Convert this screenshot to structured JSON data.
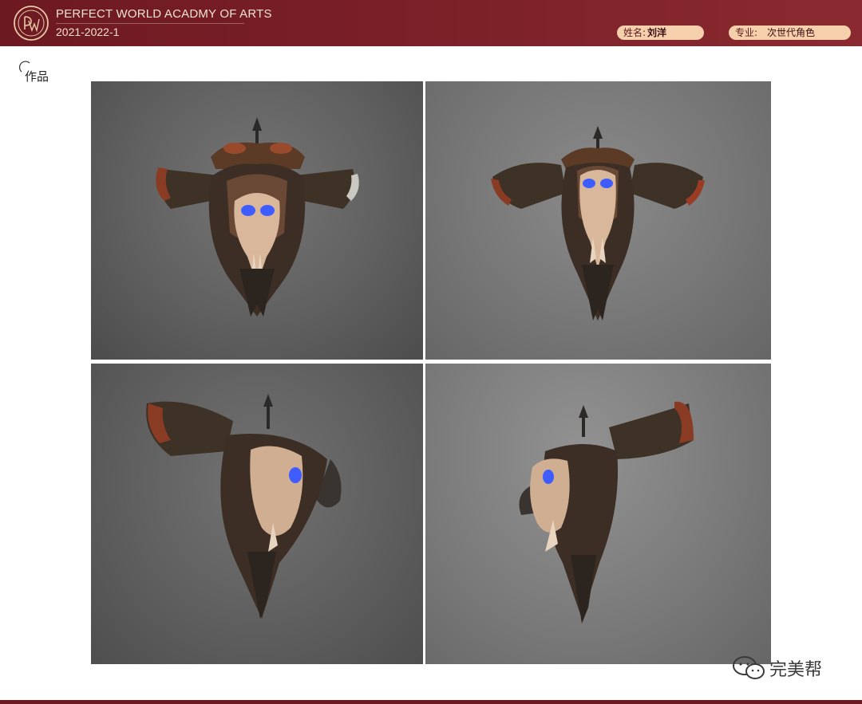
{
  "header": {
    "school": "PERFECT WORLD ACADMY OF ARTS",
    "year": "2021-2022-1",
    "logo_monogram": "PW",
    "name_label": "姓名:",
    "name_value": "刘洋",
    "major_label": "专业:",
    "major_value": "次世代角色",
    "brand_color": "#7a1f27",
    "pill_color": "#f6d0ad"
  },
  "section": {
    "title": "作品"
  },
  "gallery": {
    "views": [
      {
        "name": "front-view"
      },
      {
        "name": "front-angled-view"
      },
      {
        "name": "left-three-quarter-view"
      },
      {
        "name": "right-three-quarter-view"
      }
    ]
  },
  "watermark": {
    "icon": "wechat-icon",
    "text": "完美帮"
  }
}
